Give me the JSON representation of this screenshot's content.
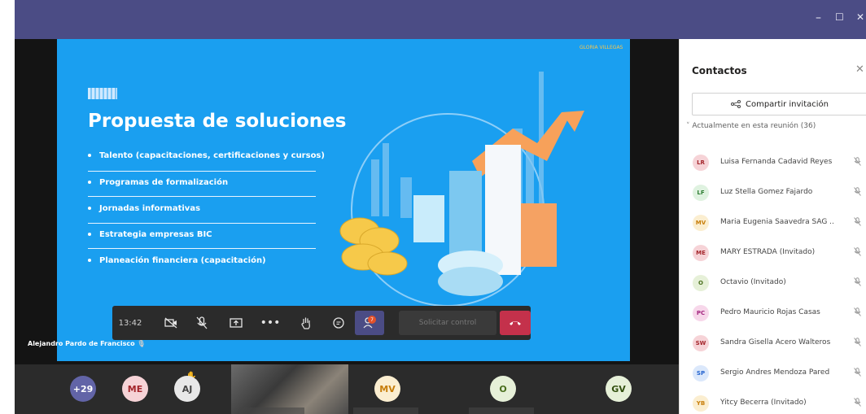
{
  "window": {
    "minimize_glyph": "–",
    "maximize_glyph": "☐",
    "close_glyph": "✕",
    "titlebar_color": "#4b4c85"
  },
  "slide": {
    "title": "Propuesta de soluciones",
    "bullets": [
      "Talento (capacitaciones, certificaciones y cursos)",
      "Programas de formalización",
      "Jornadas informativas",
      "Estrategia empresas BIC",
      "Planeación financiera (capacitación)"
    ],
    "background_color": "#1a9ff0"
  },
  "controls": {
    "time": "13:42",
    "people_badge": "7",
    "request_control_label": "Solicitar control",
    "icons": [
      "camera-off-icon",
      "mic-off-icon",
      "share-tray-icon",
      "more-icon",
      "raise-hand-icon",
      "chat-icon",
      "people-icon",
      "hang-up-icon"
    ]
  },
  "presenter_name": "Alejandro Pardo de Francisco",
  "participants_strip": {
    "overflow": "+29",
    "tiles": [
      "ME",
      "AJ",
      "MV",
      "O",
      "GV"
    ],
    "gloria_label": "GLORIA VILLEGAS"
  },
  "contacts_panel": {
    "title": "Contactos",
    "invite_label": "Compartir invitación",
    "section_label": "Actualmente en esta reunión (36)",
    "people": [
      {
        "initials": "LR",
        "name": "Luisa Fernanda Cadavid Reyes",
        "color": "#f6d3d7",
        "text": "#a4262c"
      },
      {
        "initials": "LF",
        "name": "Luz Stella Gomez Fajardo",
        "color": "#dff2e0",
        "text": "#2e7d32"
      },
      {
        "initials": "MV",
        "name": "Maria Eugenia Saavedra SAG ..",
        "color": "#fbeed0",
        "text": "#c77d09"
      },
      {
        "initials": "ME",
        "name": "MARY ESTRADA (Invitado)",
        "color": "#f6d3d7",
        "text": "#a4262c"
      },
      {
        "initials": "O",
        "name": "Octavio (Invitado)",
        "color": "#e6f0d8",
        "text": "#4a6e1d"
      },
      {
        "initials": "PC",
        "name": "Pedro Mauricio Rojas Casas",
        "color": "#f7d7ea",
        "text": "#a32680"
      },
      {
        "initials": "SW",
        "name": "Sandra Gisella Acero Walteros",
        "color": "#f6d3d7",
        "text": "#a4262c"
      },
      {
        "initials": "SP",
        "name": "Sergio Andres Mendoza Pared",
        "color": "#dbe8fb",
        "text": "#2564cf"
      },
      {
        "initials": "YB",
        "name": "Yitcy Becerra (Invitado)",
        "color": "#fbeed0",
        "text": "#c77d09"
      }
    ]
  }
}
